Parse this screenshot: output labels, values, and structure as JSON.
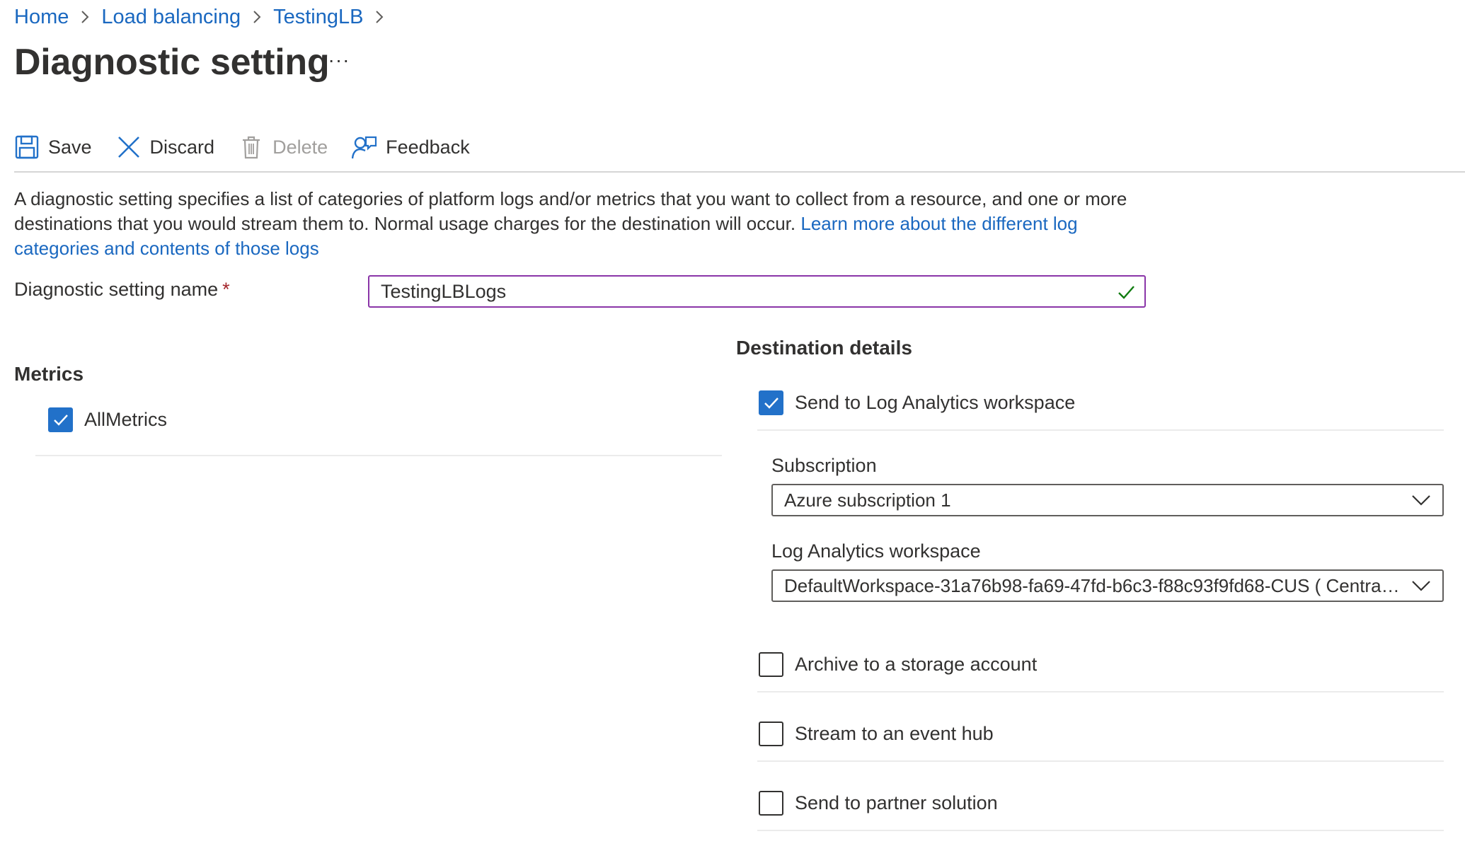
{
  "breadcrumb": {
    "items": [
      "Home",
      "Load balancing",
      "TestingLB"
    ]
  },
  "page": {
    "title": "Diagnostic setting",
    "more_label": "···"
  },
  "toolbar": {
    "save_label": "Save",
    "discard_label": "Discard",
    "delete_label": "Delete",
    "feedback_label": "Feedback"
  },
  "description": {
    "text": "A diagnostic setting specifies a list of categories of platform logs and/or metrics that you want to collect from a resource, and one or more destinations that you would stream them to. Normal usage charges for the destination will occur. ",
    "link_text": "Learn more about the different log categories and contents of those logs"
  },
  "name_field": {
    "label": "Diagnostic setting name",
    "required_mark": "*",
    "value": "TestingLBLogs",
    "valid": true
  },
  "metrics": {
    "title": "Metrics",
    "items": [
      {
        "label": "AllMetrics",
        "checked": true
      }
    ]
  },
  "destination": {
    "title": "Destination details",
    "log_analytics": {
      "label": "Send to Log Analytics workspace",
      "checked": true,
      "subscription_label": "Subscription",
      "subscription_value": "Azure subscription 1",
      "workspace_label": "Log Analytics workspace",
      "workspace_value": "DefaultWorkspace-31a76b98-fa69-47fd-b6c3-f88c93f9fd68-CUS ( Central ..."
    },
    "storage": {
      "label": "Archive to a storage account",
      "checked": false
    },
    "event_hub": {
      "label": "Stream to an event hub",
      "checked": false
    },
    "partner": {
      "label": "Send to partner solution",
      "checked": false
    }
  },
  "colors": {
    "link": "#1a68c0",
    "checkbox_checked": "#2271c9",
    "input_focus_border": "#8a35a8",
    "valid_check": "#107c10",
    "required": "#a4262c"
  },
  "icons": {
    "save": "save-icon",
    "discard": "close-icon",
    "delete": "trash-icon",
    "feedback": "feedback-person-icon",
    "breadcrumb_separator": "chevron-right-icon",
    "dropdown": "chevron-down-icon",
    "valid": "checkmark-icon"
  }
}
